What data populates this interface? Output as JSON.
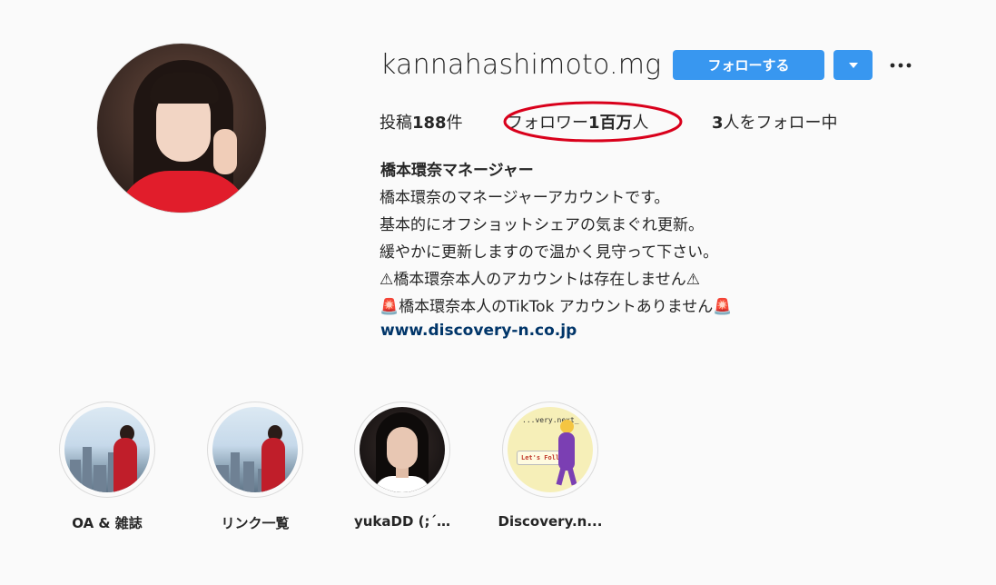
{
  "profile": {
    "username": "kannahashimoto.mg",
    "follow_label": "フォローする",
    "dropdown_icon": "caret-down-icon",
    "more_icon": "more-options-icon"
  },
  "stats": {
    "posts_label": "投稿",
    "posts_count": "188",
    "posts_suffix": "件",
    "followers_label": "フォロワー",
    "followers_count": "1百万",
    "followers_suffix": "人",
    "following_count": "3",
    "following_label": "人をフォロー中"
  },
  "bio": {
    "name": "橋本環奈マネージャー",
    "lines": [
      "橋本環奈のマネージャーアカウントです。",
      "基本的にオフショットシェアの気まぐれ更新。",
      "緩やかに更新しますので温かく見守って下さい。",
      "⚠橋本環奈本人のアカウントは存在しません⚠",
      "🚨橋本環奈本人のTikTok アカウントありません🚨"
    ],
    "link": "www.discovery-n.co.jp"
  },
  "highlights": [
    {
      "label": "OA & 雑誌"
    },
    {
      "label": "リンク一覧"
    },
    {
      "label": "yukaDD (;´…"
    },
    {
      "label": "Discovery.n..."
    }
  ],
  "highlight_4_texts": {
    "tag": "...very.next_",
    "lets": "Let's Follow"
  },
  "colors": {
    "accent": "#3897f0",
    "link": "#003569",
    "annotation": "#d9001b"
  }
}
